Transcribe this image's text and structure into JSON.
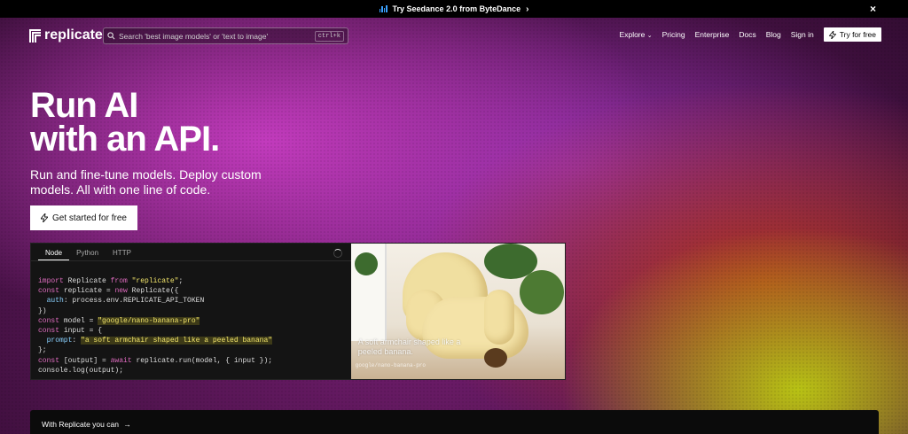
{
  "announcement": {
    "text": "Try Seedance 2.0 from ByteDance",
    "chevron": "›",
    "close": "×"
  },
  "nav": {
    "brand": "replicate",
    "search_placeholder": "Search 'best image models' or 'text to image'",
    "shortcut": "ctrl+k",
    "links": {
      "explore": "Explore",
      "pricing": "Pricing",
      "enterprise": "Enterprise",
      "docs": "Docs",
      "blog": "Blog",
      "signin": "Sign in"
    },
    "try_label": "Try for free"
  },
  "hero": {
    "title_line1": "Run AI",
    "title_line2": "with an API.",
    "subtitle": "Run and fine-tune models. Deploy custom models. All with one line of code.",
    "cta_label": "Get started for free"
  },
  "code_panel": {
    "tabs": [
      "Node",
      "Python",
      "HTTP"
    ],
    "active_tab": "Node",
    "model": "google/nano-banana-pro",
    "prompt": "a soft armchair shaped like a peeled banana",
    "lines": {
      "l1a": "import",
      "l1b": " Replicate ",
      "l1c": "from",
      "l1d": " \"replicate\"",
      "l1e": ";",
      "l2a": "const",
      "l2b": " replicate = ",
      "l2c": "new",
      "l2d": " Replicate({",
      "l3a": "  auth",
      "l3b": ": process.env.REPLICATE_API_TOKEN",
      "l4": "})",
      "l5a": "const",
      "l5b": " model = ",
      "l5c": "\"google/nano-banana-pro\"",
      "l6a": "const",
      "l6b": " input = {",
      "l7a": "  prompt",
      "l7b": ": ",
      "l7c": "\"a soft armchair shaped like a peeled banana\"",
      "l8": "};",
      "l9a": "const",
      "l9b": " [output] = ",
      "l9c": "await",
      "l9d": " replicate.run(model, { input });",
      "l10": "console.log(output);"
    },
    "image_caption": "A soft armchair shaped like a peeled banana.",
    "image_model": "google/nano-banana-pro"
  },
  "bottom": {
    "text": "With Replicate you can",
    "arrow": "→"
  },
  "colors": {
    "accent_blue": "#3aa0ff",
    "code_keyword": "#e06cc0",
    "code_string": "#f2e56b"
  }
}
